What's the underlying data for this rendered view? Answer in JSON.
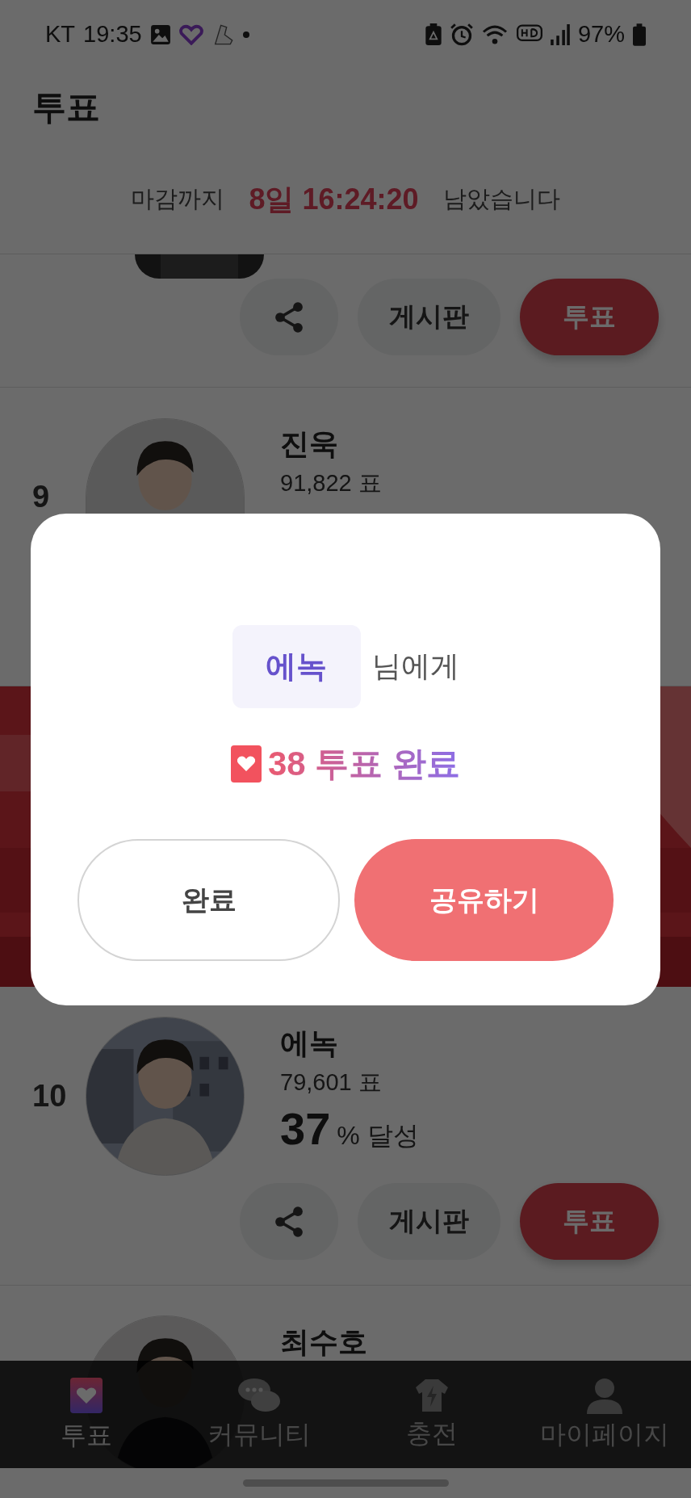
{
  "status_bar": {
    "carrier": "KT",
    "time": "19:35",
    "battery": "97%"
  },
  "header": {
    "title": "투표"
  },
  "countdown": {
    "prefix": "마감까지",
    "time": "8일 16:24:20",
    "suffix": "남았습니다"
  },
  "rows": [
    {
      "kind": "cut",
      "buttons": {
        "board": "게시판",
        "vote": "투표"
      }
    },
    {
      "kind": "candidate",
      "rank": "9",
      "name": "진욱",
      "votes": "91,822 표"
    },
    {
      "kind": "banner"
    },
    {
      "kind": "candidate",
      "rank": "10",
      "name": "에녹",
      "votes": "79,601 표",
      "percent": "37",
      "percent_suffix": "% 달성",
      "buttons": {
        "board": "게시판",
        "vote": "투표"
      }
    },
    {
      "kind": "candidate",
      "name": "최수호"
    }
  ],
  "dialog": {
    "recipient": "에녹",
    "recipient_suffix": "님에게",
    "result": "38 투표 완료",
    "buttons": [
      {
        "label": "완료",
        "kind": "outline"
      },
      {
        "label": "공유하기",
        "kind": "primary"
      }
    ]
  },
  "nav": [
    {
      "label": "투표",
      "selected": true
    },
    {
      "label": "커뮤니티",
      "selected": false
    },
    {
      "label": "충전",
      "selected": false
    },
    {
      "label": "마이페이지",
      "selected": false
    }
  ]
}
